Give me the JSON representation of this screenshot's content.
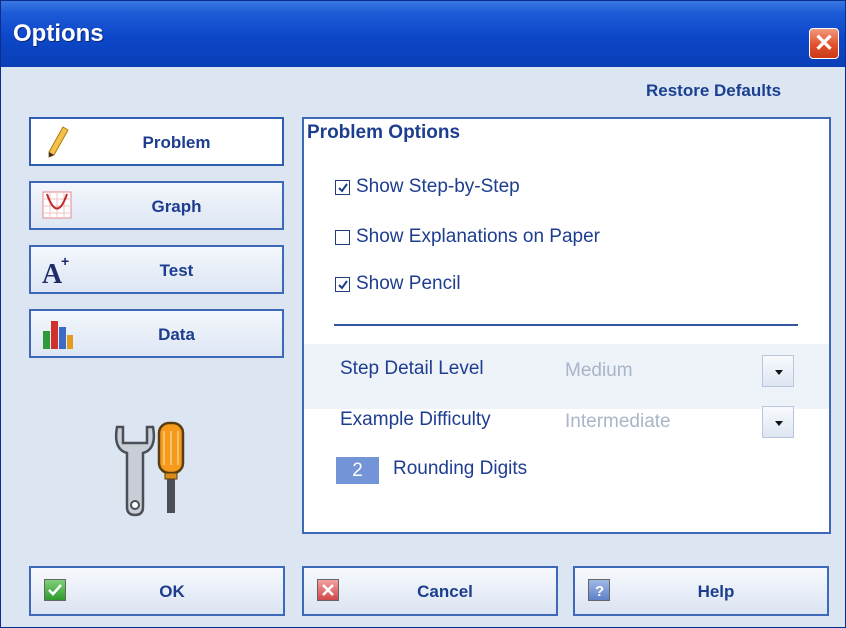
{
  "window": {
    "title": "Options",
    "close_glyph": "✕"
  },
  "restore_defaults": "Restore Defaults",
  "nav": [
    {
      "label": "Problem",
      "icon": "pencil-icon",
      "active": true
    },
    {
      "label": "Graph",
      "icon": "graph-icon",
      "active": false
    },
    {
      "label": "Test",
      "icon": "a-plus-icon",
      "active": false
    },
    {
      "label": "Data",
      "icon": "bar-chart-icon",
      "active": false
    }
  ],
  "panel": {
    "title": "Problem Options",
    "checkboxes": [
      {
        "label": "Show Step-by-Step",
        "checked": true
      },
      {
        "label": "Show Explanations on Paper",
        "checked": false
      },
      {
        "label": "Show Pencil",
        "checked": true
      }
    ],
    "step_detail": {
      "label": "Step Detail Level",
      "value": "Medium"
    },
    "example_difficulty": {
      "label": "Example Difficulty",
      "value": "Intermediate"
    },
    "rounding": {
      "value": "2",
      "label": "Rounding Digits"
    }
  },
  "buttons": {
    "ok": "OK",
    "cancel": "Cancel",
    "help": "Help"
  },
  "colors": {
    "title_bar": "#0c47c9",
    "label_text": "#1d3d8f",
    "panel_border": "#3d69b8",
    "digits_bg": "#7394d6"
  }
}
